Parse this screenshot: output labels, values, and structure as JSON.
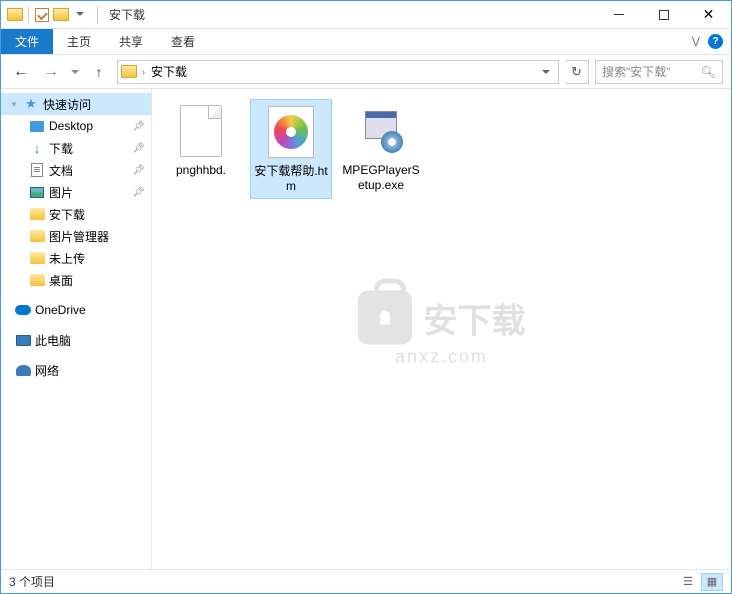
{
  "window": {
    "title": "安下载"
  },
  "ribbon": {
    "tabs": {
      "file": "文件",
      "home": "主页",
      "share": "共享",
      "view": "查看"
    }
  },
  "address": {
    "current": "安下载",
    "search_placeholder": "搜索\"安下载\""
  },
  "sidebar": {
    "quick_access": "快速访问",
    "items": [
      {
        "label": "Desktop",
        "icon": "desktop",
        "pinned": true
      },
      {
        "label": "下载",
        "icon": "download",
        "pinned": true
      },
      {
        "label": "文档",
        "icon": "document",
        "pinned": true
      },
      {
        "label": "图片",
        "icon": "picture",
        "pinned": true
      },
      {
        "label": "安下载",
        "icon": "folder",
        "pinned": false
      },
      {
        "label": "图片管理器",
        "icon": "folder",
        "pinned": false
      },
      {
        "label": "未上传",
        "icon": "folder",
        "pinned": false
      },
      {
        "label": "桌面",
        "icon": "folder",
        "pinned": false
      }
    ],
    "top": [
      {
        "label": "OneDrive",
        "icon": "onedrive"
      },
      {
        "label": "此电脑",
        "icon": "pc"
      },
      {
        "label": "网络",
        "icon": "network"
      }
    ]
  },
  "files": [
    {
      "name": "pnghhbd.",
      "type": "blank"
    },
    {
      "name": "安下载帮助.htm",
      "type": "htm",
      "selected": true
    },
    {
      "name": "MPEGPlayerSetup.exe",
      "type": "exe"
    }
  ],
  "status": {
    "count": "3 个项目"
  },
  "watermark": {
    "text": "安下载",
    "url": "anxz.com"
  }
}
